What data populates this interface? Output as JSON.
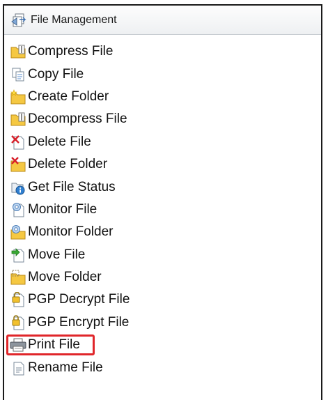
{
  "panel": {
    "title": "File Management",
    "icon": "file-management-icon"
  },
  "items": [
    {
      "label": "Compress File",
      "icon": "compress-file-icon",
      "selected": false
    },
    {
      "label": "Copy File",
      "icon": "copy-file-icon",
      "selected": false
    },
    {
      "label": "Create Folder",
      "icon": "create-folder-icon",
      "selected": false
    },
    {
      "label": "Decompress File",
      "icon": "decompress-file-icon",
      "selected": false
    },
    {
      "label": "Delete File",
      "icon": "delete-file-icon",
      "selected": false
    },
    {
      "label": "Delete Folder",
      "icon": "delete-folder-icon",
      "selected": false
    },
    {
      "label": "Get File Status",
      "icon": "file-status-icon",
      "selected": false
    },
    {
      "label": "Monitor File",
      "icon": "monitor-file-icon",
      "selected": false
    },
    {
      "label": "Monitor Folder",
      "icon": "monitor-folder-icon",
      "selected": false
    },
    {
      "label": "Move File",
      "icon": "move-file-icon",
      "selected": false
    },
    {
      "label": "Move Folder",
      "icon": "move-folder-icon",
      "selected": false
    },
    {
      "label": "PGP Decrypt File",
      "icon": "pgp-decrypt-icon",
      "selected": false
    },
    {
      "label": "PGP Encrypt File",
      "icon": "pgp-encrypt-icon",
      "selected": false
    },
    {
      "label": "Print File",
      "icon": "printer-icon",
      "selected": true
    },
    {
      "label": "Rename File",
      "icon": "rename-file-icon",
      "selected": false
    }
  ],
  "colors": {
    "highlight_border": "#e0262a",
    "folder": "#f5c842",
    "delete_red": "#d8202a",
    "info_blue": "#2f7fd0",
    "move_green": "#3aa935"
  }
}
